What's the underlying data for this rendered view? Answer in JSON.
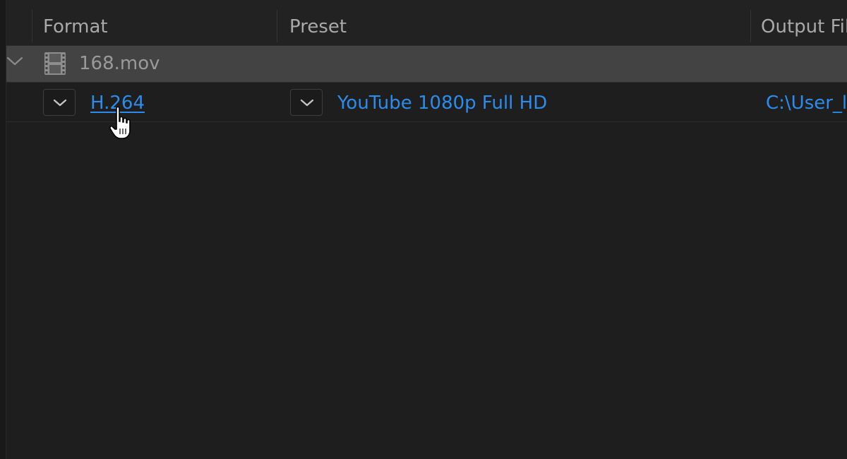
{
  "header": {
    "columns": [
      {
        "label": "Format"
      },
      {
        "label": "Preset"
      },
      {
        "label": "Output Fil"
      }
    ]
  },
  "queue": {
    "group": {
      "expanded": true,
      "file_name": "168.mov",
      "icon": "film-icon"
    },
    "output": {
      "format": "H.264",
      "preset": "YouTube 1080p Full HD",
      "output_file": "C:\\User_l"
    }
  },
  "colors": {
    "background": "#1e1e1e",
    "group_row": "#434343",
    "link": "#2d8ceb",
    "header_text": "#a9a9a9"
  },
  "cursor": "hand-pointer-icon"
}
